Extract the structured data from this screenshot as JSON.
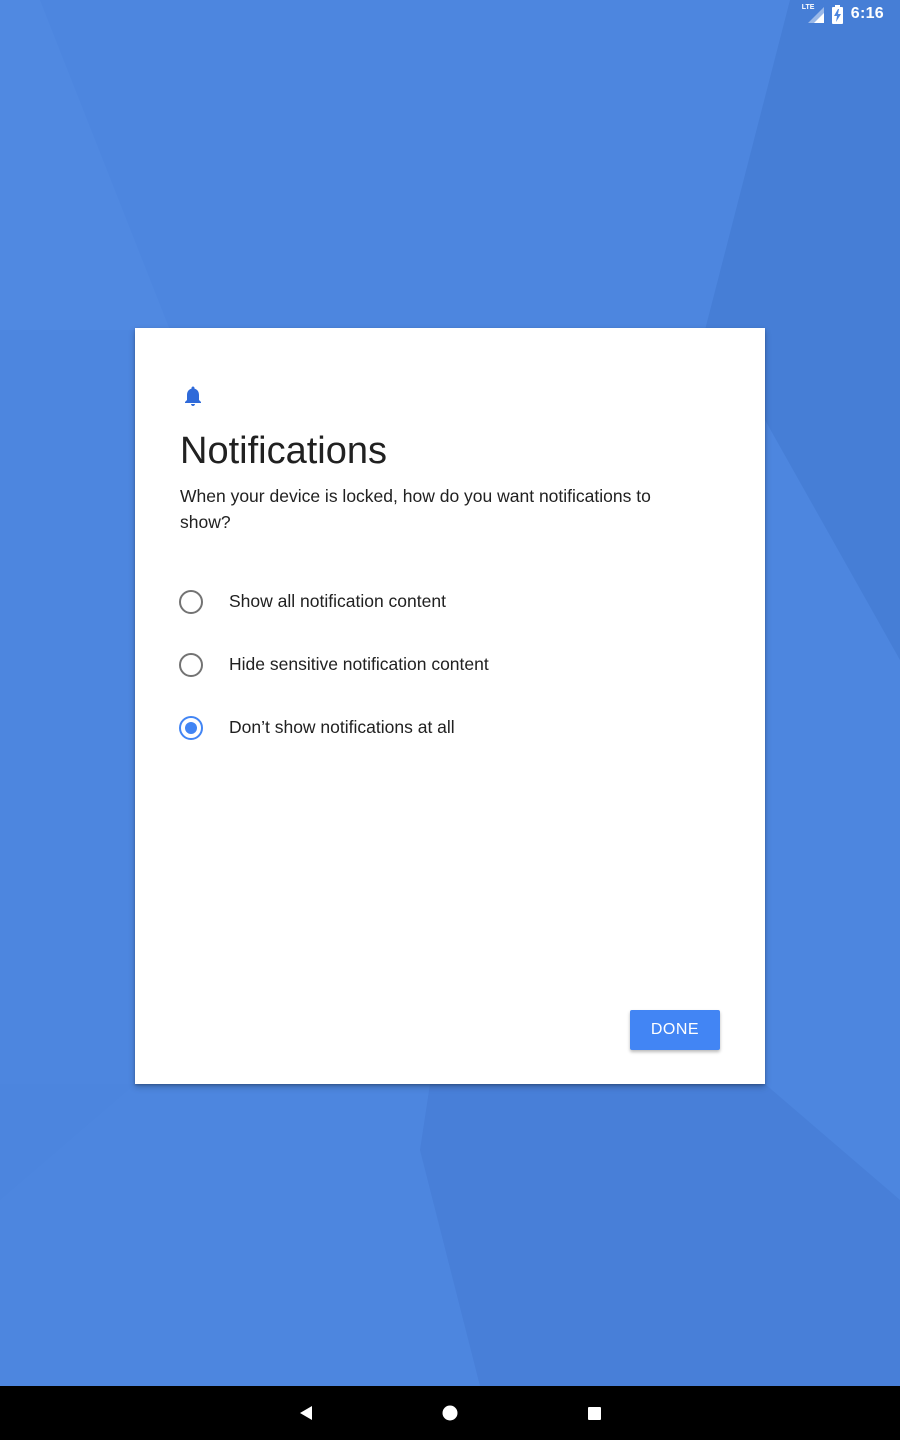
{
  "status_bar": {
    "network_label": "LTE",
    "time": "6:16"
  },
  "dialog": {
    "icon": "bell-icon",
    "title": "Notifications",
    "subtitle": "When your device is locked, how do you want notifications to show?",
    "options": [
      {
        "label": "Show all notification content",
        "selected": false
      },
      {
        "label": "Hide sensitive notification content",
        "selected": false
      },
      {
        "label": "Don’t show notifications at all",
        "selected": true
      }
    ],
    "done_label": "DONE"
  },
  "colors": {
    "background": "#4d86df",
    "accent": "#4285f4",
    "icon_blue": "#2f6ad9",
    "text": "#212121",
    "nav_bar": "#000000"
  },
  "nav_bar": {
    "buttons": [
      "back-icon",
      "home-icon",
      "recents-icon"
    ]
  }
}
